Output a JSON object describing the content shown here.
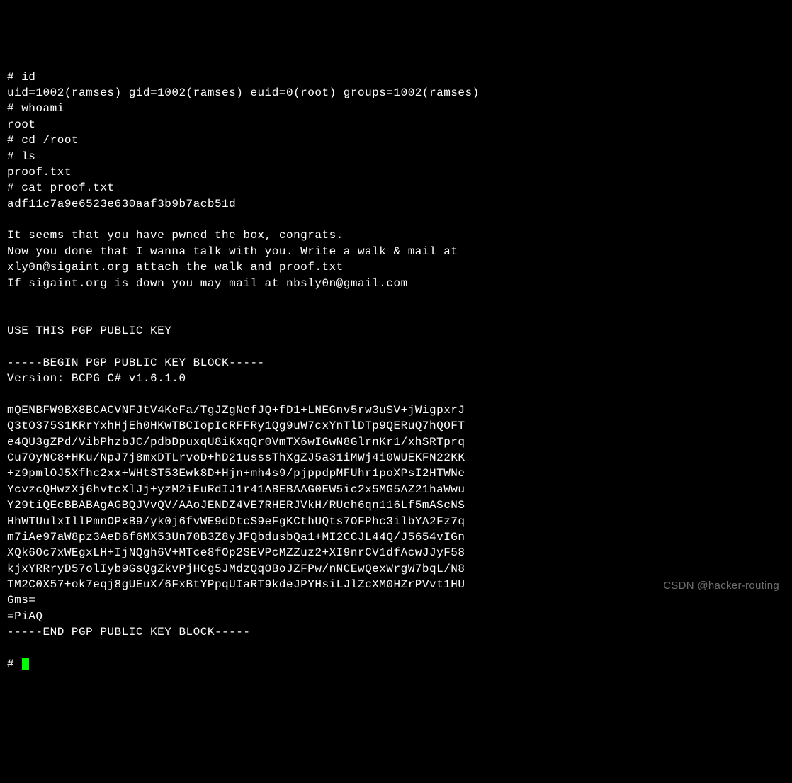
{
  "terminal": {
    "lines": [
      "# id",
      "uid=1002(ramses) gid=1002(ramses) euid=0(root) groups=1002(ramses)",
      "# whoami",
      "root",
      "# cd /root",
      "# ls",
      "proof.txt",
      "# cat proof.txt",
      "adf11c7a9e6523e630aaf3b9b7acb51d",
      "",
      "It seems that you have pwned the box, congrats.",
      "Now you done that I wanna talk with you. Write a walk & mail at",
      "xly0n@sigaint.org attach the walk and proof.txt",
      "If sigaint.org is down you may mail at nbsly0n@gmail.com",
      "",
      "",
      "USE THIS PGP PUBLIC KEY",
      "",
      "-----BEGIN PGP PUBLIC KEY BLOCK-----",
      "Version: BCPG C# v1.6.1.0",
      "",
      "mQENBFW9BX8BCACVNFJtV4KeFa/TgJZgNefJQ+fD1+LNEGnv5rw3uSV+jWigpxrJ",
      "Q3tO375S1KRrYxhHjEh0HKwTBCIopIcRFFRy1Qg9uW7cxYnTlDTp9QERuQ7hQOFT",
      "e4QU3gZPd/VibPhzbJC/pdbDpuxqU8iKxqQr0VmTX6wIGwN8GlrnKr1/xhSRTprq",
      "Cu7OyNC8+HKu/NpJ7j8mxDTLrvoD+hD21usssThXgZJ5a31iMWj4i0WUEKFN22KK",
      "+z9pmlOJ5Xfhc2xx+WHtST53Ewk8D+Hjn+mh4s9/pjppdpMFUhr1poXPsI2HTWNe",
      "YcvzcQHwzXj6hvtcXlJj+yzM2iEuRdIJ1r41ABEBAAG0EW5ic2x5MG5AZ21haWwu",
      "Y29tiQEcBBABAgAGBQJVvQV/AAoJENDZ4VE7RHERJVkH/RUeh6qn116Lf5mAScNS",
      "HhWTUulxIllPmnOPxB9/yk0j6fvWE9dDtcS9eFgKCthUQts7OFPhc3ilbYA2Fz7q",
      "m7iAe97aW8pz3AeD6f6MX53Un70B3Z8yJFQbdusbQa1+MI2CCJL44Q/J5654vIGn",
      "XQk6Oc7xWEgxLH+IjNQgh6V+MTce8fOp2SEVPcMZZuz2+XI9nrCV1dfAcwJJyF58",
      "kjxYRRryD57olIyb9GsQgZkvPjHCg5JMdzQqOBoJZFPw/nNCEwQexWrgW7bqL/N8",
      "TM2C0X57+ok7eqj8gUEuX/6FxBtYPpqUIaRT9kdeJPYHsiLJlZcXM0HZrPVvt1HU",
      "Gms=",
      "=PiAQ",
      "-----END PGP PUBLIC KEY BLOCK-----",
      ""
    ],
    "prompt_final": "# "
  },
  "watermark": "CSDN @hacker-routing"
}
